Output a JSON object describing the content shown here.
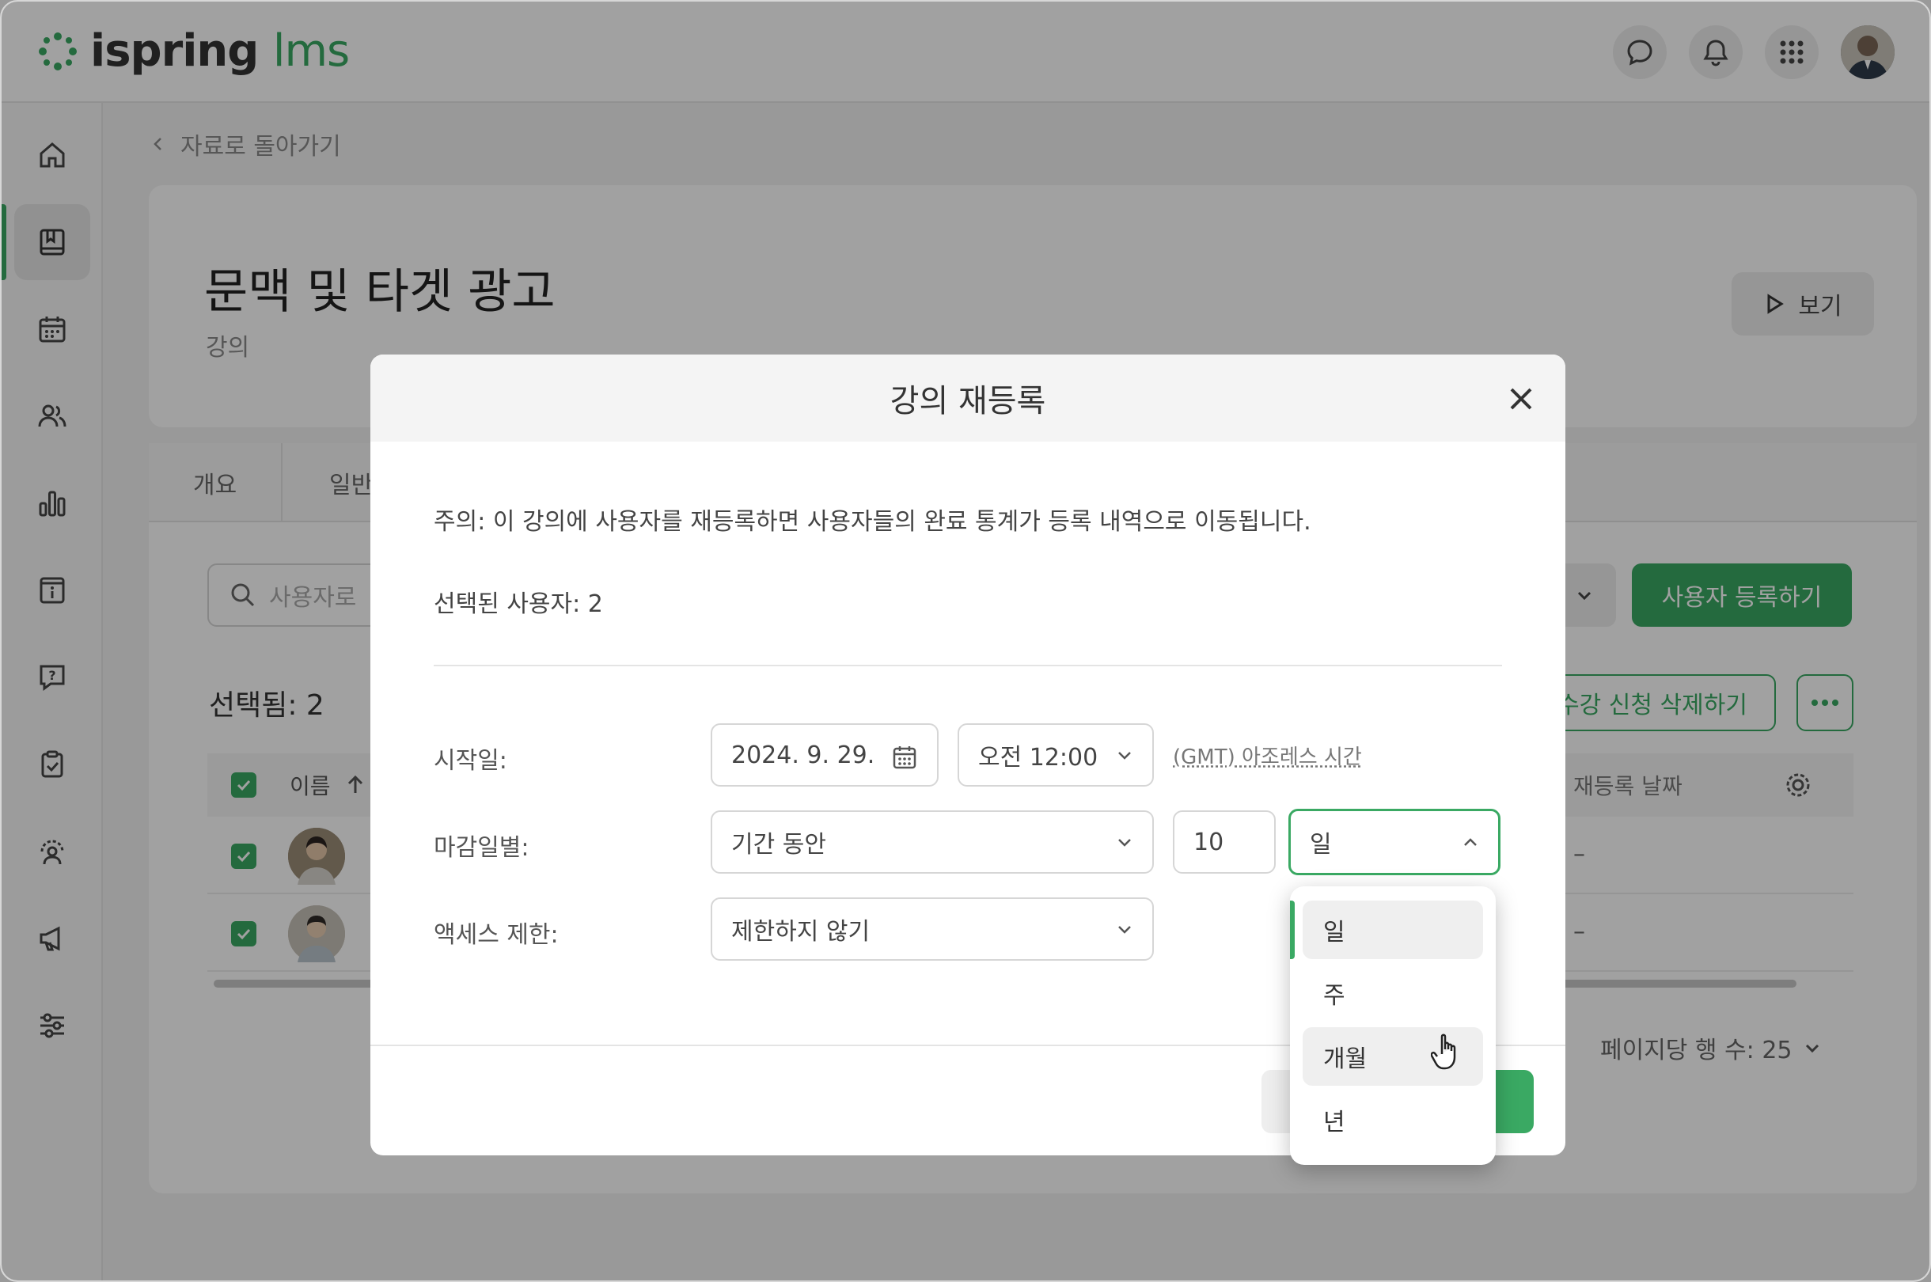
{
  "app": {
    "logo_main": "ispring",
    "logo_accent": "lms"
  },
  "topbar": {
    "icons": [
      "chat-icon",
      "bell-icon",
      "apps-grid-icon",
      "user-avatar"
    ]
  },
  "sidebar": {
    "items": [
      "home-icon",
      "courses-icon",
      "calendar-icon",
      "users-icon",
      "reports-icon",
      "info-icon",
      "help-icon",
      "assignments-icon",
      "support-icon",
      "announcements-icon",
      "settings-icon"
    ],
    "active_index": 1
  },
  "page": {
    "back_label": "자료로 돌아가기",
    "course_title": "문맥 및 타겟 광고",
    "course_type": "강의",
    "view_label": "보기",
    "tabs": [
      "개요",
      "일반"
    ],
    "search_placeholder": "사용자로",
    "enroll_label": "사용자 등록하기",
    "selected_label": "선택됨: 2",
    "unenroll_label": "수강 신청 삭제하기",
    "table": {
      "col_name": "이름",
      "col_reenroll": "재등록 날짜",
      "rows": [
        {
          "reenroll": "–"
        },
        {
          "reenroll": "–"
        }
      ]
    },
    "rows_per_page": "페이지당 행 수: 25"
  },
  "modal": {
    "title": "강의 재등록",
    "notice": "주의: 이 강의에 사용자를 재등록하면 사용자들의 완료 통계가 등록 내역으로 이동됩니다.",
    "selected_users": "선택된 사용자: 2",
    "start_label": "시작일:",
    "start_date": "2024. 9. 29.",
    "start_time": "오전 12:00",
    "timezone": "(GMT) 아조레스 시간",
    "due_label": "마감일별:",
    "due_mode": "기간 동안",
    "due_amount": "10",
    "due_unit": "일",
    "access_label": "액세스 제한:",
    "access_value": "제한하지 않기"
  },
  "unit_menu": {
    "options": [
      "일",
      "주",
      "개월",
      "년"
    ],
    "selected": "일",
    "hovered": "개월"
  },
  "colors": {
    "accent": "#3aa963",
    "overlay": "rgba(0,0,0,0.37)"
  }
}
